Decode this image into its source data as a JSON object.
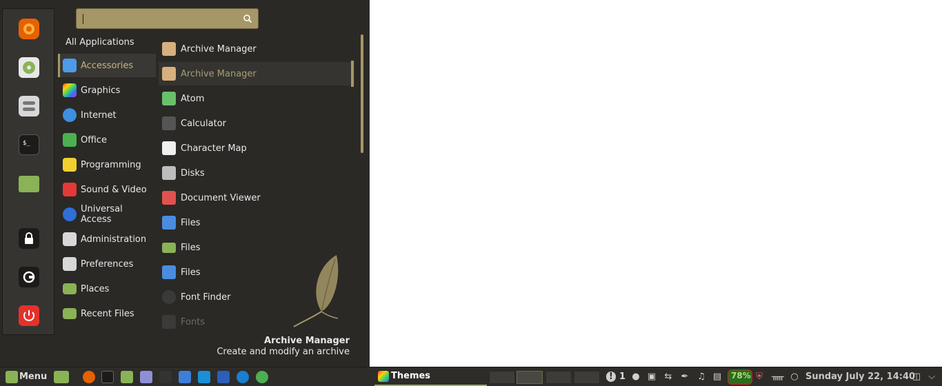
{
  "search": {
    "value": "",
    "placeholder": ""
  },
  "favorites": [
    {
      "name": "firefox-icon",
      "color": "#e66100"
    },
    {
      "name": "software-manager-icon",
      "color": "#8ab356"
    },
    {
      "name": "settings-icon",
      "color": "#d0d0d0"
    },
    {
      "name": "terminal-icon",
      "color": "#1c1b19"
    },
    {
      "name": "files-icon",
      "color": "#8ab356"
    },
    {
      "name": "lock-icon",
      "color": "#2a2926"
    },
    {
      "name": "logout-icon",
      "color": "#2a2926"
    },
    {
      "name": "power-icon",
      "color": "#e3322c"
    }
  ],
  "categories": {
    "header": "All Applications",
    "items": [
      {
        "label": "Accessories",
        "icon": "accessories-icon",
        "color": "#4d9ae8"
      },
      {
        "label": "Graphics",
        "icon": "graphics-icon",
        "color": "#c03cd2"
      },
      {
        "label": "Internet",
        "icon": "internet-icon",
        "color": "#3d8fe0"
      },
      {
        "label": "Office",
        "icon": "office-icon",
        "color": "#4caf50"
      },
      {
        "label": "Programming",
        "icon": "programming-icon",
        "color": "#f0d030"
      },
      {
        "label": "Sound & Video",
        "icon": "sound-video-icon",
        "color": "#e53935"
      },
      {
        "label": "Universal Access",
        "icon": "universal-access-icon",
        "color": "#2f6fd6"
      },
      {
        "label": "Administration",
        "icon": "administration-icon",
        "color": "#d8d8d8"
      },
      {
        "label": "Preferences",
        "icon": "preferences-icon",
        "color": "#d8d8d8"
      },
      {
        "label": "Places",
        "icon": "places-folder-icon",
        "color": "#8ab356"
      },
      {
        "label": "Recent Files",
        "icon": "recent-files-icon",
        "color": "#8ab356"
      }
    ]
  },
  "apps": [
    {
      "label": "Archive Manager",
      "icon": "archive-manager-icon",
      "color": "#d6b07e"
    },
    {
      "label": "Archive Manager",
      "icon": "archive-manager-icon",
      "color": "#d6b07e"
    },
    {
      "label": "Atom",
      "icon": "atom-icon",
      "color": "#6abf69"
    },
    {
      "label": "Calculator",
      "icon": "calculator-icon",
      "color": "#555555"
    },
    {
      "label": "Character Map",
      "icon": "character-map-icon",
      "color": "#f0f0f0"
    },
    {
      "label": "Disks",
      "icon": "disks-icon",
      "color": "#bdbdbd"
    },
    {
      "label": "Document Viewer",
      "icon": "document-viewer-icon",
      "color": "#e0524f"
    },
    {
      "label": "Files",
      "icon": "files-icon",
      "color": "#4a8ce0"
    },
    {
      "label": "Files",
      "icon": "files-folder-icon",
      "color": "#8ab356"
    },
    {
      "label": "Files",
      "icon": "files-icon",
      "color": "#4a8ce0"
    },
    {
      "label": "Font Finder",
      "icon": "font-finder-icon",
      "color": "#3a3a3a"
    },
    {
      "label": "Fonts",
      "icon": "fonts-icon",
      "color": "#555555"
    }
  ],
  "description": {
    "title": "Archive Manager",
    "subtitle": "Create and modify an archive"
  },
  "panel": {
    "menu_label": "Menu",
    "task_label": "Themes",
    "notification_count": "1",
    "battery": "78%",
    "clock": "Sunday July 22, 14:40",
    "launchers": [
      {
        "name": "files-icon",
        "color": "#8ab356"
      },
      {
        "name": "firefox-icon",
        "color": "#e66100"
      },
      {
        "name": "terminal-icon",
        "color": "#1c1b19"
      },
      {
        "name": "folder-icon",
        "color": "#8ab356"
      },
      {
        "name": "text-editor-icon",
        "color": "#8f8fd8"
      },
      {
        "name": "system-monitor-icon",
        "color": "#333333"
      },
      {
        "name": "document-icon",
        "color": "#3d7fd8"
      },
      {
        "name": "app-icon",
        "color": "#1a8fd8"
      },
      {
        "name": "virtualbox-icon",
        "color": "#2b5fb8"
      },
      {
        "name": "web-icon",
        "color": "#1a7fd0"
      },
      {
        "name": "chrome-icon",
        "color": "#4caf50"
      }
    ]
  }
}
